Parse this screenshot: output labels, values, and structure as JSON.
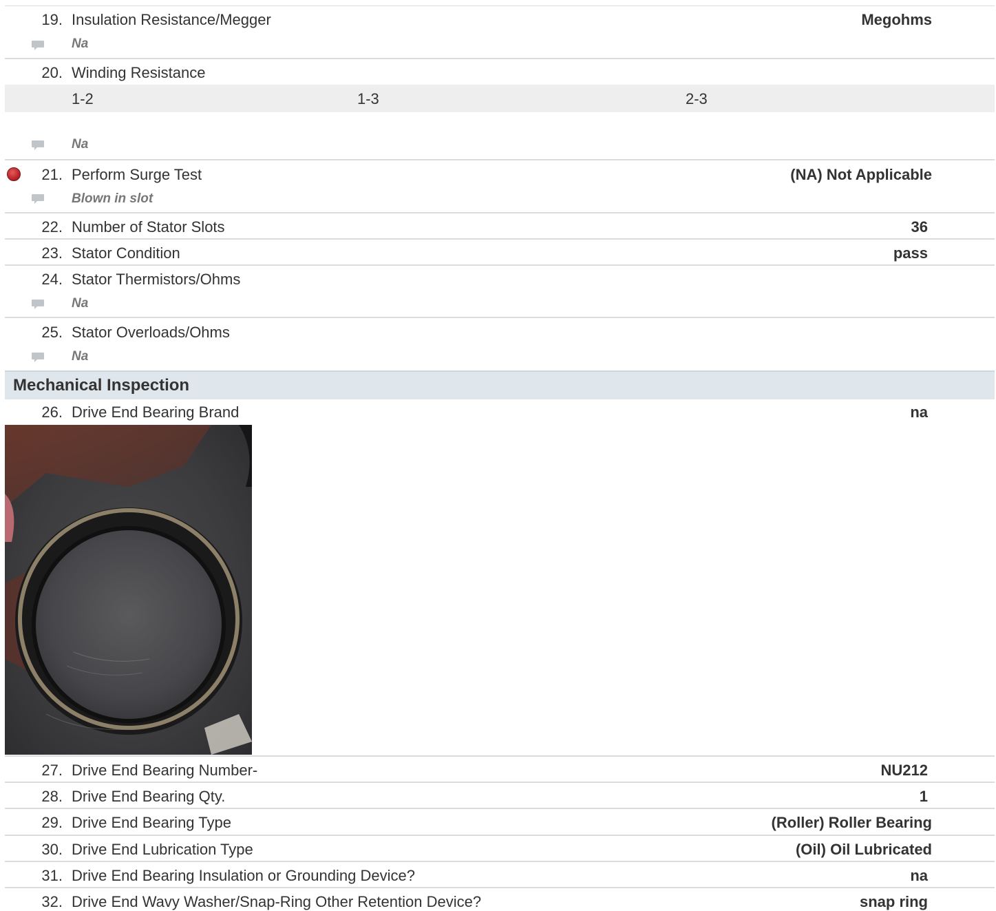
{
  "items": {
    "i19": {
      "num": "19.",
      "label": "Insulation Resistance/Megger",
      "value": "Megohms",
      "note": "Na"
    },
    "i20": {
      "num": "20.",
      "label": "Winding Resistance",
      "columns": [
        "1-2",
        "1-3",
        "2-3"
      ],
      "note": "Na"
    },
    "i21": {
      "num": "21.",
      "label": "Perform Surge Test",
      "value": "(NA) Not Applicable",
      "note": "Blown in slot"
    },
    "i22": {
      "num": "22.",
      "label": "Number of Stator Slots",
      "value": "36"
    },
    "i23": {
      "num": "23.",
      "label": "Stator Condition",
      "value": "pass"
    },
    "i24": {
      "num": "24.",
      "label": "Stator Thermistors/Ohms",
      "note": "Na"
    },
    "i25": {
      "num": "25.",
      "label": "Stator Overloads/Ohms",
      "note": "Na"
    },
    "i26": {
      "num": "26.",
      "label": "Drive End Bearing Brand",
      "value": "na"
    },
    "i27": {
      "num": "27.",
      "label": "Drive End Bearing Number-",
      "value": "NU212"
    },
    "i28": {
      "num": "28.",
      "label": "Drive End Bearing Qty.",
      "value": "1"
    },
    "i29": {
      "num": "29.",
      "label": "Drive End Bearing Type",
      "value": "(Roller) Roller Bearing"
    },
    "i30": {
      "num": "30.",
      "label": "Drive End Lubrication Type",
      "value": "(Oil) Oil Lubricated"
    },
    "i31": {
      "num": "31.",
      "label": "Drive End Bearing Insulation or Grounding Device?",
      "value": "na"
    },
    "i32": {
      "num": "32.",
      "label": "Drive End Wavy Washer/Snap-Ring Other Retention Device?",
      "value": "snap ring"
    }
  },
  "sections": {
    "mechanical": {
      "title": "Mechanical Inspection"
    }
  },
  "icons": {
    "comment": "comment-icon",
    "fail_indicator": "red-dot-icon"
  },
  "colors": {
    "section_bg": "#dfe6ec",
    "subrow_bg": "#eeeeee",
    "fail_dot": "#c0282d",
    "note_text": "#777777"
  }
}
